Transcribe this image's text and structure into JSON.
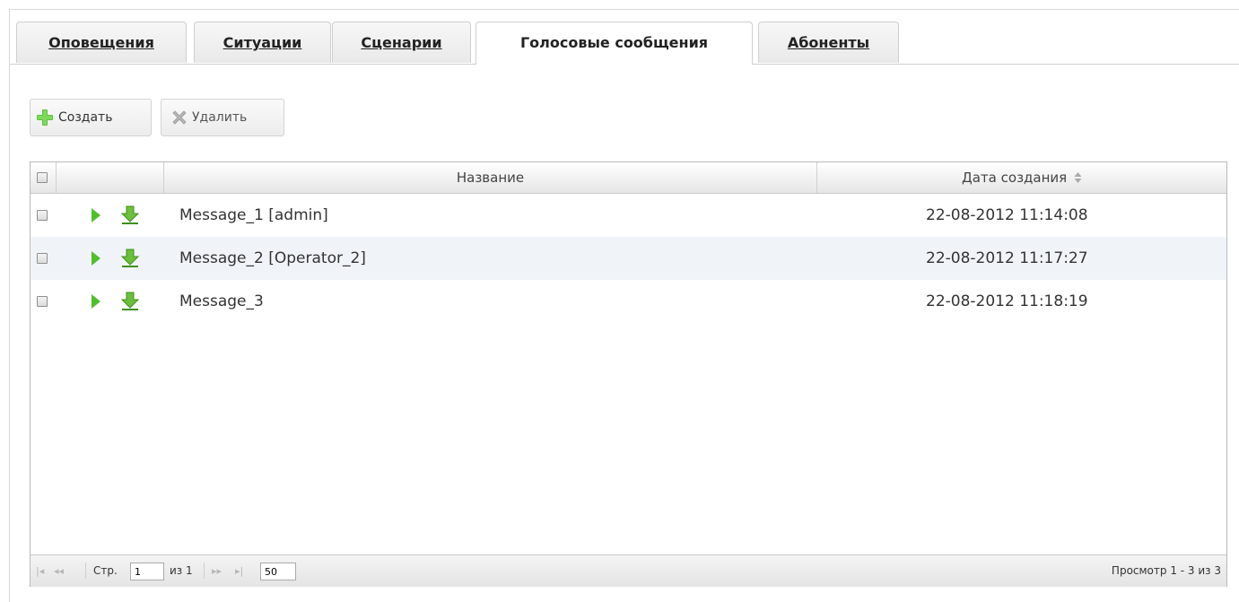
{
  "tabs": [
    {
      "label": "Оповещения",
      "active": false
    },
    {
      "label": "Ситуации",
      "active": false
    },
    {
      "label": "Сценарии",
      "active": false
    },
    {
      "label": "Голосовые сообщения",
      "active": true
    },
    {
      "label": "Абоненты",
      "active": false
    }
  ],
  "toolbar": {
    "create_label": "Создать",
    "create_icon": "plus-icon",
    "delete_label": "Удалить",
    "delete_icon": "delete-x-icon"
  },
  "grid": {
    "columns": {
      "name": "Название",
      "date": "Дата создания"
    },
    "sort_icon": "sort-arrows-icon",
    "rows": [
      {
        "name": "Message_1 [admin]",
        "date": "22-08-2012 11:14:08"
      },
      {
        "name": "Message_2 [Operator_2]",
        "date": "22-08-2012 11:17:27"
      },
      {
        "name": "Message_3",
        "date": "22-08-2012 11:18:19"
      }
    ],
    "row_icons": [
      "play-icon",
      "download-icon"
    ]
  },
  "pager": {
    "first": "|◂",
    "prev": "◂◂",
    "page_label": "Стр.",
    "page_value": "1",
    "of_label": "из 1",
    "next": "▸▸",
    "last": "▸|",
    "page_size": "50",
    "info": "Просмотр 1 - 3 из 3"
  },
  "colors": {
    "accent_green": "#4fbf2c",
    "row_alt": "#f0f4f8"
  }
}
